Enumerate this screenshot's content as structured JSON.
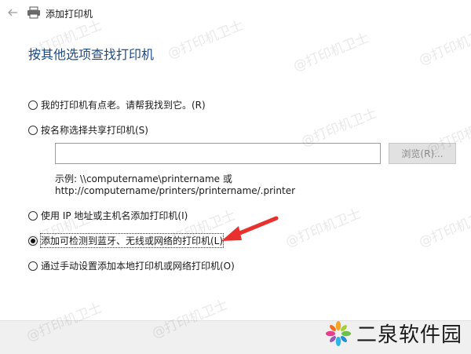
{
  "window": {
    "title": "添加打印机"
  },
  "heading": "按其他选项查找打印机",
  "options": [
    {
      "label": "我的打印机有点老。请帮我找到它。(R)",
      "checked": false
    },
    {
      "label": "按名称选择共享打印机(S)",
      "checked": false
    },
    {
      "label": "使用 IP 地址或主机名添加打印机(I)",
      "checked": false
    },
    {
      "label": "添加可检测到蓝牙、无线或网络的打印机(L)",
      "checked": true
    },
    {
      "label": "通过手动设置添加本地打印机或网络打印机(O)",
      "checked": false
    }
  ],
  "share_input": {
    "value": "",
    "placeholder": ""
  },
  "browse_label": "浏览(R)...",
  "example": {
    "line1": "示例: \\\\computername\\printername 或",
    "line2": "http://computername/printers/printername/.printer"
  },
  "watermark": "@打印机卫士",
  "logo_text": "二泉软件园",
  "colors": {
    "heading": "#1e4a86",
    "arrow": "#e8312e",
    "footer": "#f0f0f0"
  }
}
